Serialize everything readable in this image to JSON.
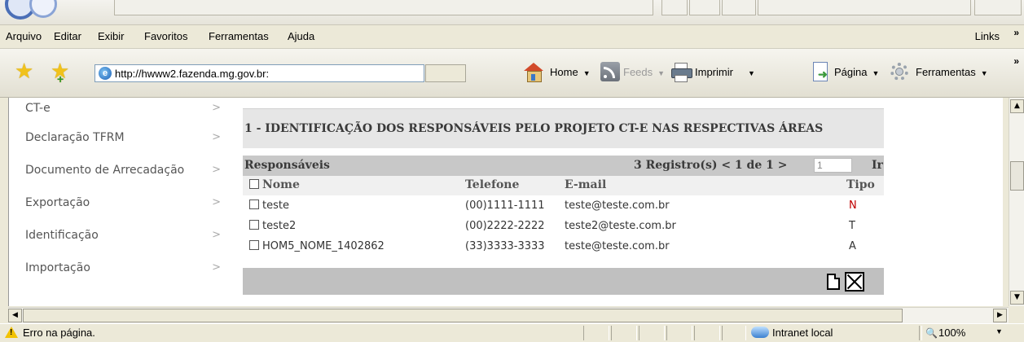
{
  "menu": {
    "items": [
      "Arquivo",
      "Editar",
      "Exibir",
      "Favoritos",
      "Ferramentas",
      "Ajuda"
    ],
    "links": "Links",
    "overflow": "»"
  },
  "toolbar": {
    "url": "http://hwww2.fazenda.mg.gov.br:",
    "home": "Home",
    "feeds": "Feeds",
    "print": "Imprimir",
    "page": "Página",
    "tools": "Ferramentas",
    "overflow": "»"
  },
  "sidebar": {
    "items": [
      {
        "label": "CT-e"
      },
      {
        "label": "Declaração TFRM"
      },
      {
        "label": "Documento de Arrecadação"
      },
      {
        "label": "Exportação"
      },
      {
        "label": "Identificação"
      },
      {
        "label": "Importação"
      }
    ],
    "arrow": ">"
  },
  "section": {
    "title": "1 - IDENTIFICAÇÃO DOS RESPONSÁVEIS PELO PROJETO CT-E NAS RESPECTIVAS ÁREAS"
  },
  "grid": {
    "title": "Responsáveis",
    "pager_text": "3 Registro(s) < 1 de 1 >",
    "page_value": "1",
    "go_label": "Ir",
    "columns": [
      "Nome",
      "Telefone",
      "E-mail",
      "Tipo"
    ],
    "rows": [
      {
        "nome": "teste",
        "telefone": "(00)1111-1111",
        "email": "teste@teste.com.br",
        "tipo": "N"
      },
      {
        "nome": "teste2",
        "telefone": "(00)2222-2222",
        "email": "teste2@teste.com.br",
        "tipo": "T"
      },
      {
        "nome": "HOM5_NOME_1402862",
        "telefone": "(33)3333-3333",
        "email": "teste@teste.com.br",
        "tipo": "A"
      }
    ]
  },
  "status": {
    "text": "Erro na página.",
    "zone": "Intranet local",
    "zoom": "100%"
  },
  "colors": {
    "chrome": "#ece9d8",
    "grid_header": "#c8c8c8",
    "section_header": "#e6e6e6",
    "tipo_n": "#c00000"
  }
}
